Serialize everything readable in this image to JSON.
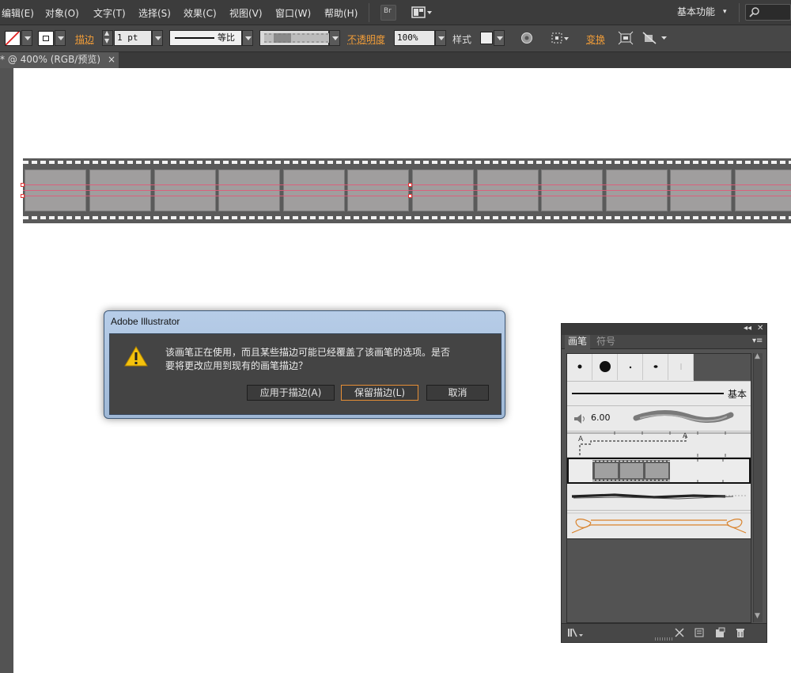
{
  "menubar": {
    "items": [
      "编辑(E)",
      "对象(O)",
      "文字(T)",
      "选择(S)",
      "效果(C)",
      "视图(V)",
      "窗口(W)",
      "帮助(H)"
    ],
    "bridge_label": "Br",
    "workspace": "基本功能"
  },
  "controlbar": {
    "stroke_label": "描边",
    "stroke_weight": "1 pt",
    "profile_label": "等比",
    "opacity_label": "不透明度",
    "opacity_value": "100%",
    "style_label": "样式",
    "transform_label": "变换"
  },
  "doc_tab": {
    "title": "* @ 400% (RGB/预览)",
    "close": "×"
  },
  "dialog": {
    "title": "Adobe Illustrator",
    "message_line1": "该画笔正在使用，而且某些描边可能已经覆盖了该画笔的选项。是否",
    "message_line2": "要将更改应用到现有的画笔描边？",
    "buttons": {
      "apply": "应用于描边(A)",
      "keep": "保留描边(L)",
      "cancel": "取消"
    }
  },
  "brush_panel": {
    "collapse": "◂◂",
    "close": "✕",
    "tabs": [
      "画笔",
      "符号"
    ],
    "basic_label": "基本",
    "size_value": "6.00"
  },
  "colors": {
    "app_bg": "#535353",
    "menubar": "#3c3c3c",
    "orange_label": "#f29d38",
    "film_strip": "#5a5a5a",
    "film_frame": "#a09e9e",
    "guide": "#e05a78",
    "dialog_frame": "#b7cde8"
  }
}
